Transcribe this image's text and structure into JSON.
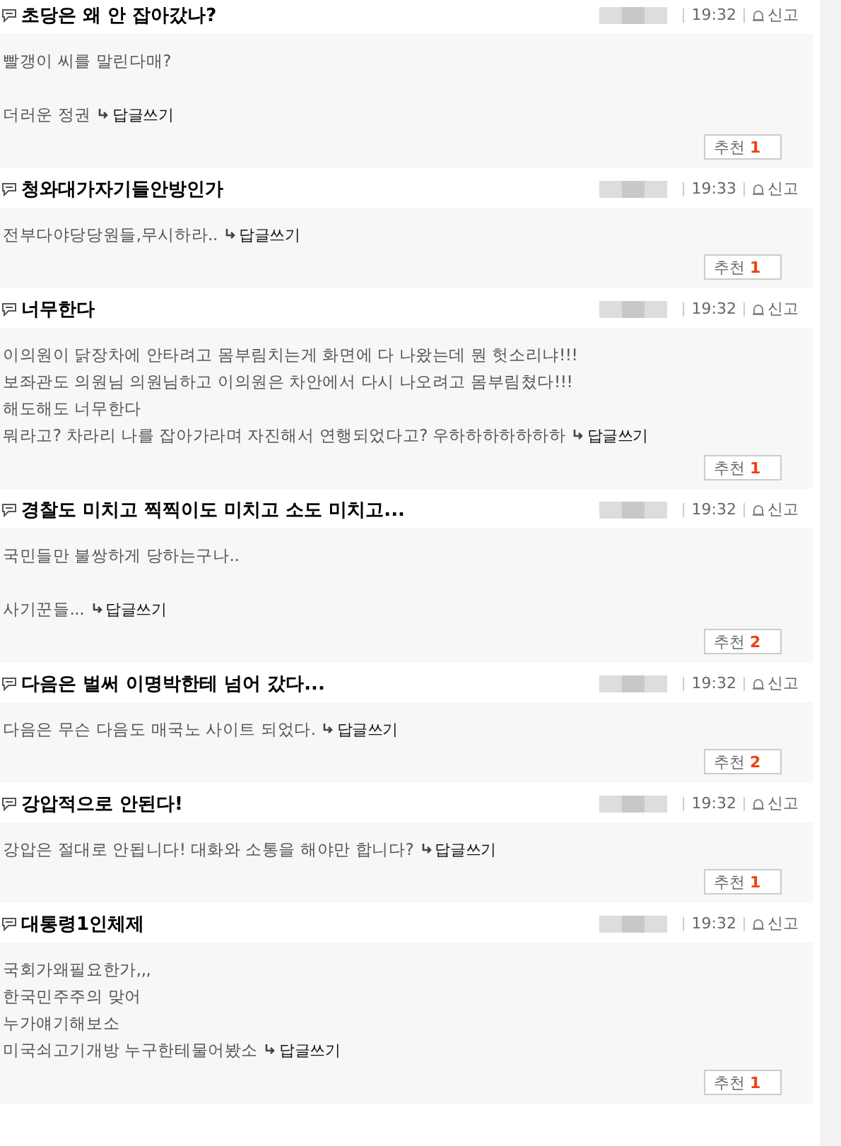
{
  "comments": [
    {
      "title": "초당은 왜 안 잡아갔나?",
      "time": "19:32",
      "report": "신고",
      "paragraphs": [
        [
          "빨갱이 씨를 말린다매?"
        ],
        [
          "더러운 정권"
        ]
      ],
      "reply": "답글쓰기",
      "recommend_label": "추천",
      "recommend_count": "1"
    },
    {
      "title": "청와대가자기들안방인가",
      "time": "19:33",
      "report": "신고",
      "paragraphs": [
        [
          "전부다야당당원들,무시하라.."
        ]
      ],
      "reply": "답글쓰기",
      "recommend_label": "추천",
      "recommend_count": "1"
    },
    {
      "title": "너무한다",
      "time": "19:32",
      "report": "신고",
      "paragraphs": [
        [
          "이의원이 닭장차에 안타려고 몸부림치는게 화면에 다 나왔는데 뭔 헛소리냐!!!",
          "보좌관도 의원님 의원님하고 이의원은 차안에서 다시 나오려고 몸부림쳤다!!!",
          "해도해도 너무한다",
          "뭐라고? 차라리 나를 잡아가라며 자진해서 연행되었다고? 우하하하하하하하"
        ]
      ],
      "reply": "답글쓰기",
      "recommend_label": "추천",
      "recommend_count": "1"
    },
    {
      "title": "경찰도 미치고 찍찍이도 미치고 소도 미치고...",
      "time": "19:32",
      "report": "신고",
      "paragraphs": [
        [
          "국민들만 불쌍하게 당하는구나.."
        ],
        [
          "사기꾼들..."
        ]
      ],
      "reply": "답글쓰기",
      "recommend_label": "추천",
      "recommend_count": "2"
    },
    {
      "title": "다음은 벌써 이명박한테 넘어 갔다...",
      "time": "19:32",
      "report": "신고",
      "paragraphs": [
        [
          "다음은 무슨 다음도 매국노 사이트 되었다."
        ]
      ],
      "reply": "답글쓰기",
      "recommend_label": "추천",
      "recommend_count": "2"
    },
    {
      "title": "강압적으로 안된다!",
      "time": "19:32",
      "report": "신고",
      "paragraphs": [
        [
          "강압은 절대로 안됩니다! 대화와 소통을 해야만 합니다?"
        ]
      ],
      "reply": "답글쓰기",
      "recommend_label": "추천",
      "recommend_count": "1"
    },
    {
      "title": "대통령1인체제",
      "time": "19:32",
      "report": "신고",
      "paragraphs": [
        [
          "국회가왜필요한가,,,",
          "한국민주주의 맞어",
          "누가얘기해보소",
          "미국쇠고기개방 누구한테물어봤소"
        ]
      ],
      "reply": "답글쓰기",
      "recommend_label": "추천",
      "recommend_count": "1"
    }
  ]
}
